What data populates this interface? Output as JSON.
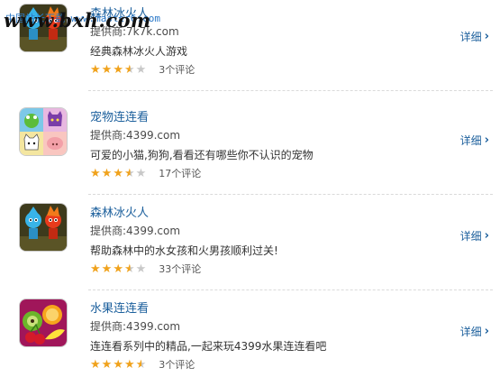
{
  "watermark": {
    "site_text": "www.bxh.com",
    "url_text": "中国站长下载 www.master6.com"
  },
  "games": [
    {
      "title": "森林冰火人",
      "provider": "提供商:7k7k.com",
      "description": "经典森林冰火人游戏",
      "rating": 3.5,
      "reviews": "3个评论",
      "detail_label": "详细",
      "icon": "fireboy-watergirl-icon"
    },
    {
      "title": "宠物连连看",
      "provider": "提供商:4399.com",
      "description": "可爱的小猫,狗狗,看看还有哪些你不认识的宠物",
      "rating": 3.5,
      "reviews": "17个评论",
      "detail_label": "详细",
      "icon": "pet-match-icon"
    },
    {
      "title": "森林冰火人",
      "provider": "提供商:4399.com",
      "description": "帮助森林中的水女孩和火男孩顺利过关!",
      "rating": 3.5,
      "reviews": "33个评论",
      "detail_label": "详细",
      "icon": "fireboy-watergirl-icon"
    },
    {
      "title": "水果连连看",
      "provider": "提供商:4399.com",
      "description": "连连看系列中的精品,一起来玩4399水果连连看吧",
      "rating": 4.5,
      "reviews": "3个评论",
      "detail_label": "详细",
      "icon": "fruit-match-icon"
    }
  ],
  "colors": {
    "title": "#1b5f9c",
    "star": "#f0a21c",
    "star_empty": "#c8c8c8"
  }
}
